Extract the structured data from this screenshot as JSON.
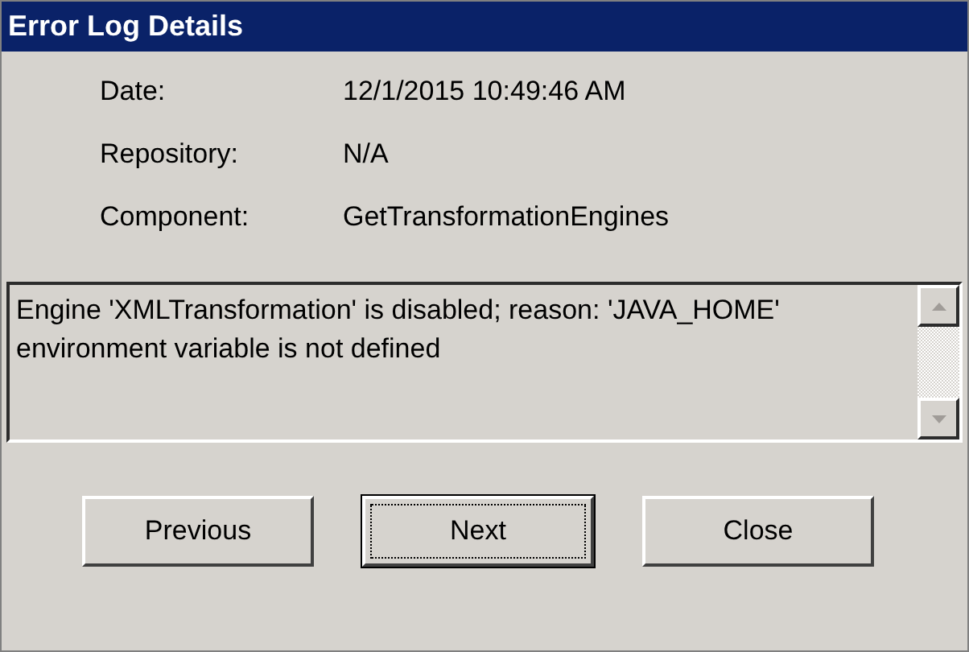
{
  "window": {
    "title": "Error Log Details"
  },
  "fields": [
    {
      "label": "Date:",
      "value": "12/1/2015 10:49:46 AM"
    },
    {
      "label": "Repository:",
      "value": "N/A"
    },
    {
      "label": "Component:",
      "value": "GetTransformationEngines"
    }
  ],
  "message": "Engine 'XMLTransformation' is disabled; reason: 'JAVA_HOME' environment variable is not defined",
  "buttons": [
    {
      "label": "Previous",
      "focused": false
    },
    {
      "label": "Next",
      "focused": true
    },
    {
      "label": "Close",
      "focused": false
    }
  ]
}
